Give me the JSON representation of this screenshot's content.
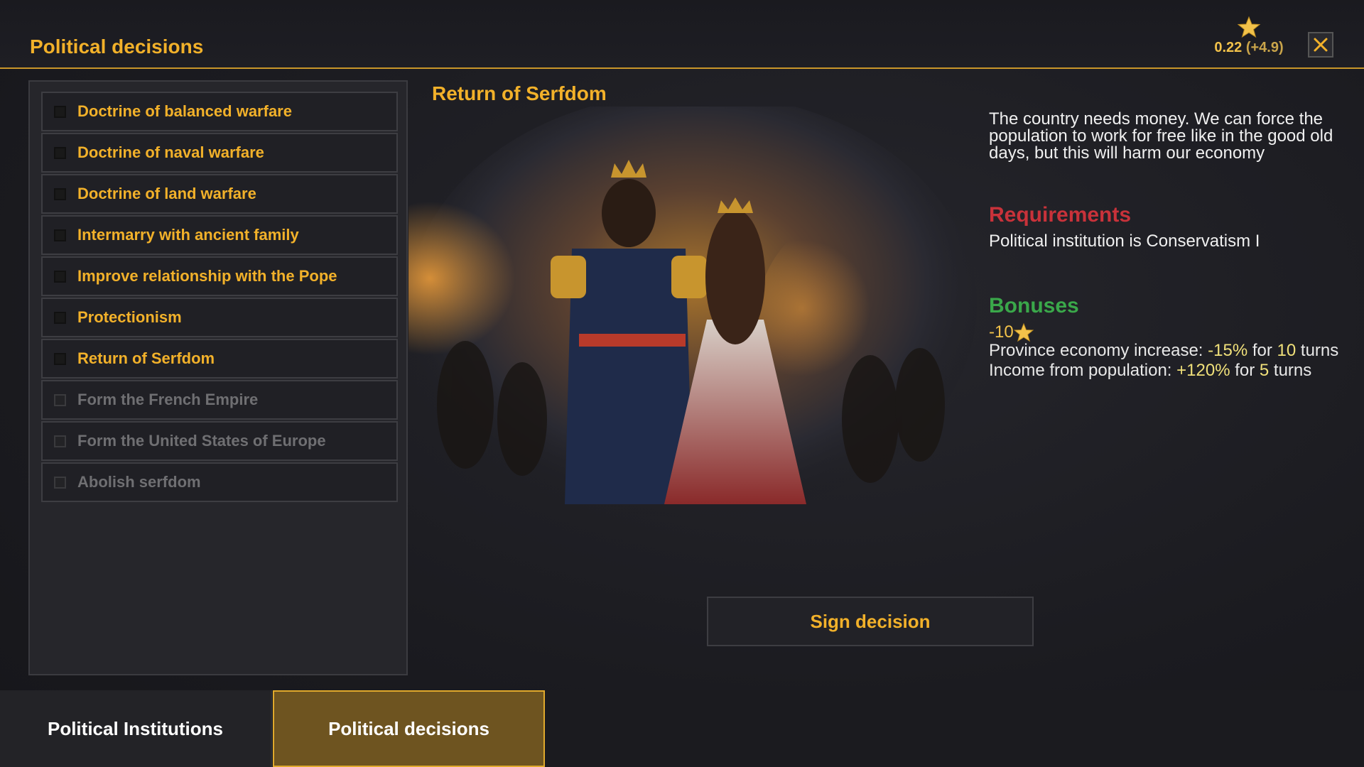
{
  "header": {
    "title": "Political decisions",
    "currency_value": "0.22",
    "currency_delta": "(+4.9)",
    "close_icon": "close-icon",
    "star_icon": "star-icon"
  },
  "decisions": [
    {
      "label": "Doctrine of balanced warfare",
      "enabled": true
    },
    {
      "label": "Doctrine of naval warfare",
      "enabled": true
    },
    {
      "label": "Doctrine of land warfare",
      "enabled": true
    },
    {
      "label": "Intermarry with ancient family",
      "enabled": true
    },
    {
      "label": "Improve relationship with the Pope",
      "enabled": true
    },
    {
      "label": "Protectionism",
      "enabled": true
    },
    {
      "label": "Return of Serfdom",
      "enabled": true
    },
    {
      "label": "Form the French Empire",
      "enabled": false
    },
    {
      "label": "Form the United States of Europe",
      "enabled": false
    },
    {
      "label": "Abolish serfdom",
      "enabled": false
    }
  ],
  "detail": {
    "title": "Return of Serfdom",
    "description": "The country needs money. We can force the population to work for free like in the good old days, but this will harm our economy",
    "requirements_heading": "Requirements",
    "requirement": "Political institution is Conservatism I",
    "bonuses_heading": "Bonuses",
    "cost": "-10",
    "bonuses": [
      {
        "label": "Province economy increase: ",
        "value": "-15%",
        "for": " for ",
        "turns": "10",
        "unit": " turns"
      },
      {
        "label": "Income from population: ",
        "value": "+120%",
        "for": " for ",
        "turns": "5",
        "unit": " turns"
      }
    ],
    "sign_button": "Sign decision"
  },
  "tabs": [
    {
      "label": "Political Institutions",
      "active": false
    },
    {
      "label": "Political decisions",
      "active": true
    }
  ],
  "colors": {
    "accent": "#f2b12a",
    "requirements": "#c8323a",
    "bonuses": "#3aa84a",
    "active_tab": "#6e5420"
  }
}
